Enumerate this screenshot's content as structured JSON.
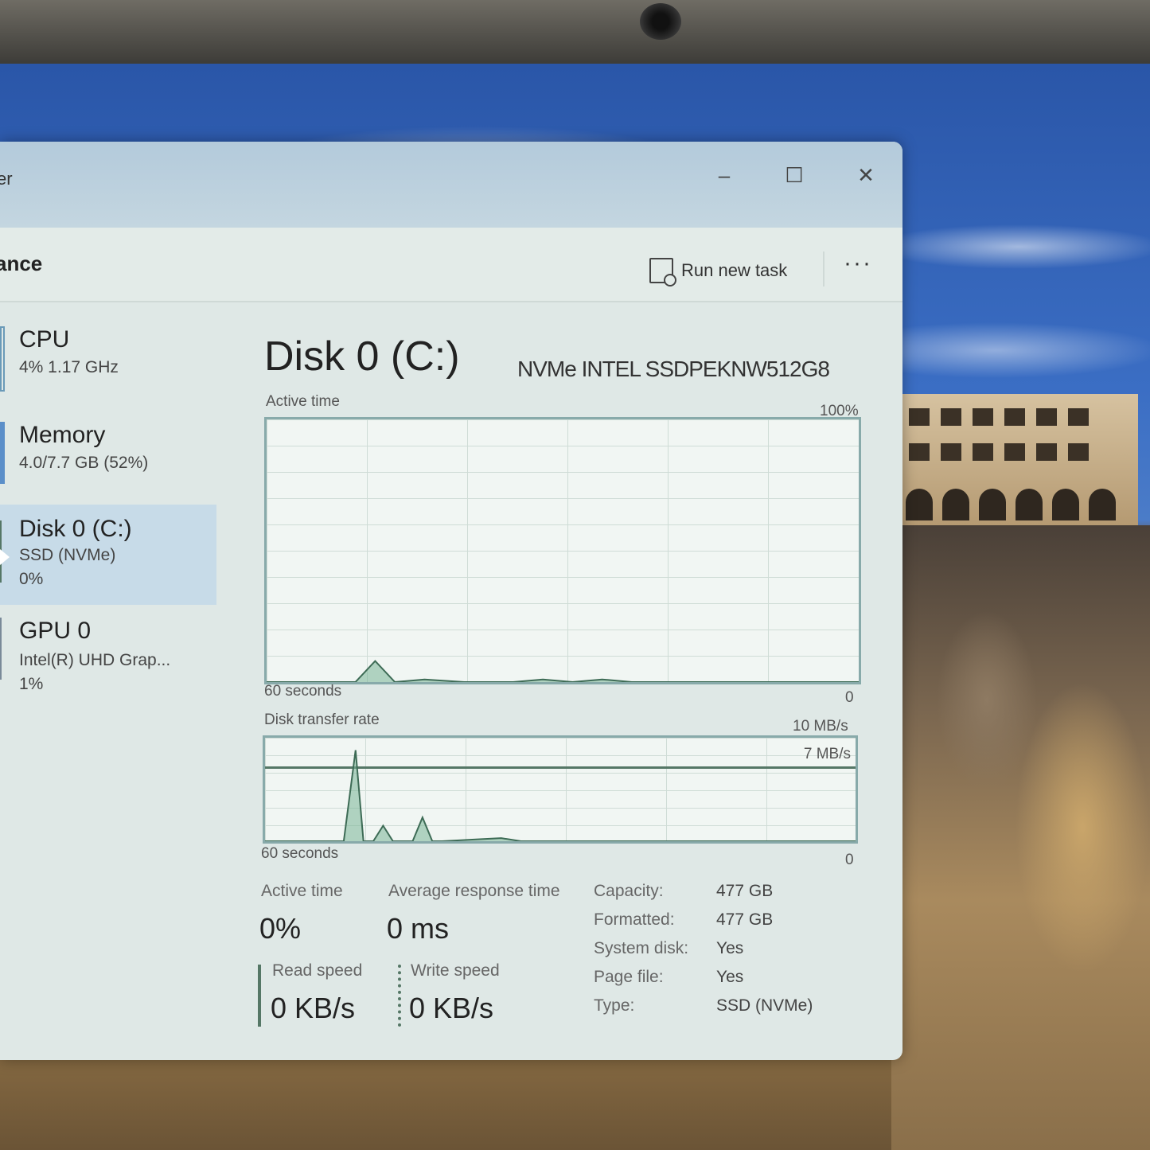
{
  "window": {
    "title_fragment": "er",
    "minimize": "–",
    "maximize": "☐",
    "close": "✕"
  },
  "toolbar": {
    "section": "ance",
    "run_new_task": "Run new task",
    "more": "···"
  },
  "sidebar": {
    "items": [
      {
        "name": "CPU",
        "sub1": "4% 1.17 GHz",
        "sub2": ""
      },
      {
        "name": "Memory",
        "sub1": "4.0/7.7 GB (52%)",
        "sub2": ""
      },
      {
        "name": "Disk 0 (C:)",
        "sub1": "SSD (NVMe)",
        "sub2": "0%"
      },
      {
        "name": "GPU 0",
        "sub1": "Intel(R) UHD Grap...",
        "sub2": "1%"
      }
    ]
  },
  "main": {
    "title": "Disk 0 (C:)",
    "model": "NVMe INTEL SSDPEKNW512G8",
    "graph1": {
      "label": "Active time",
      "max": "100%",
      "time": "60 seconds",
      "min": "0"
    },
    "graph2": {
      "label": "Disk transfer rate",
      "max": "10 MB/s",
      "line_label": "7 MB/s",
      "time": "60 seconds",
      "min": "0"
    },
    "stats": {
      "active_time_label": "Active time",
      "active_time": "0%",
      "avg_response_label": "Average response time",
      "avg_response": "0 ms",
      "read_label": "Read speed",
      "read": "0 KB/s",
      "write_label": "Write speed",
      "write": "0 KB/s"
    },
    "properties": [
      {
        "k": "Capacity:",
        "v": "477 GB"
      },
      {
        "k": "Formatted:",
        "v": "477 GB"
      },
      {
        "k": "System disk:",
        "v": "Yes"
      },
      {
        "k": "Page file:",
        "v": "Yes"
      },
      {
        "k": "Type:",
        "v": "SSD (NVMe)"
      }
    ]
  },
  "chart_data": [
    {
      "type": "area",
      "title": "Active time",
      "x": [
        0,
        5,
        9,
        11,
        13,
        16,
        20,
        25,
        28,
        31,
        34,
        37,
        40,
        60
      ],
      "values": [
        0,
        0,
        0,
        8,
        0,
        1,
        0,
        0,
        1,
        0,
        1,
        0,
        0,
        0
      ],
      "ylim": [
        0,
        100
      ],
      "xlabel": "60 seconds"
    },
    {
      "type": "area",
      "title": "Disk transfer rate",
      "x": [
        0,
        6,
        8,
        9.2,
        10,
        11,
        12,
        13,
        15,
        16,
        17,
        18,
        22,
        24,
        26,
        60
      ],
      "values": [
        0,
        0,
        0,
        8.8,
        0,
        0,
        1.5,
        0,
        0,
        2.3,
        0,
        0,
        0.2,
        0.3,
        0,
        0
      ],
      "ylim": [
        0,
        10
      ],
      "xlabel": "60 seconds"
    }
  ]
}
